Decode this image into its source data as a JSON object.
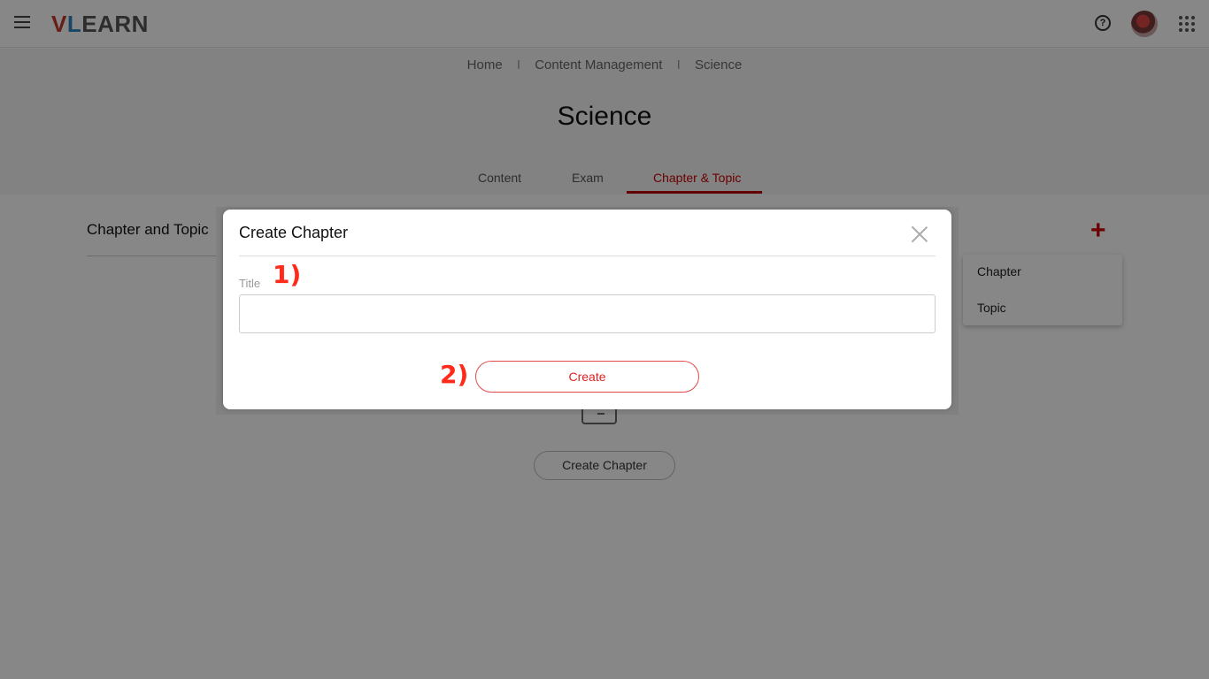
{
  "header": {
    "logo_text": "VLEARN",
    "logo_letter_v": "V",
    "logo_letter_l": "L",
    "logo_rest": "EARN",
    "help_glyph": "?",
    "icons": [
      "menu-icon",
      "help-icon",
      "avatar",
      "apps-grid-icon"
    ]
  },
  "breadcrumb": {
    "items": [
      "Home",
      "Content Management",
      "Science"
    ],
    "separator": "I"
  },
  "page_title": "Science",
  "tabs": [
    {
      "label": "Content",
      "active": false
    },
    {
      "label": "Exam",
      "active": false
    },
    {
      "label": "Chapter & Topic",
      "active": true
    }
  ],
  "section": {
    "title": "Chapter and Topic",
    "add_icon": "+",
    "create_button": "Create Chapter"
  },
  "dropdown": {
    "items": [
      "Chapter",
      "Topic"
    ]
  },
  "modal": {
    "title": "Create Chapter",
    "field_label": "Title",
    "title_value": "",
    "create_button": "Create",
    "close_icon": "close-icon"
  },
  "annotations": {
    "step1": "1)",
    "step2": "2)"
  },
  "colors": {
    "accent": "#cc0000",
    "button_border": "#e24a4a",
    "annotation": "#ff2a1a"
  }
}
